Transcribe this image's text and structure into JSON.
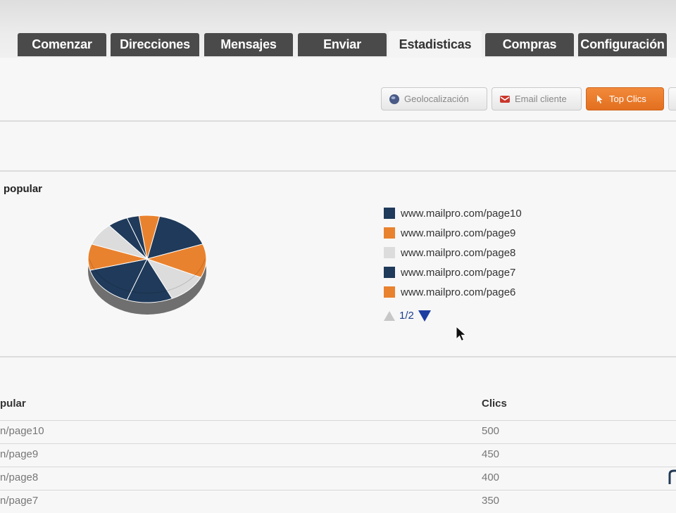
{
  "tabs": [
    {
      "label": "Comenzar",
      "active": false
    },
    {
      "label": "Direcciones",
      "active": false
    },
    {
      "label": "Mensajes",
      "active": false
    },
    {
      "label": "Enviar",
      "active": false
    },
    {
      "label": "Estadisticas",
      "active": true
    },
    {
      "label": "Compras",
      "active": false
    },
    {
      "label": "Configuración",
      "active": false
    }
  ],
  "toolbar": {
    "geo_label": "Geolocalización",
    "email_label": "Email cliente",
    "topclics_label": "Top Clics"
  },
  "section": {
    "title": "popular"
  },
  "legend": {
    "items": [
      {
        "label": "www.mailpro.com/page10",
        "color": "#1f3a5a"
      },
      {
        "label": "www.mailpro.com/page9",
        "color": "#e9822e"
      },
      {
        "label": "www.mailpro.com/page8",
        "color": "#dcdcdc"
      },
      {
        "label": "www.mailpro.com/page7",
        "color": "#1f3a5a"
      },
      {
        "label": "www.mailpro.com/page6",
        "color": "#e9822e"
      }
    ],
    "pager": "1/2"
  },
  "table": {
    "headers": [
      "pular",
      "Clics"
    ],
    "rows": [
      {
        "url": "n/page10",
        "clics": "500"
      },
      {
        "url": "n/page9",
        "clics": "450"
      },
      {
        "url": "n/page8",
        "clics": "400"
      },
      {
        "url": "n/page7",
        "clics": "350"
      }
    ]
  },
  "colors": {
    "navy": "#1f3a5a",
    "orange": "#e9822e",
    "grey": "#dcdcdc"
  }
}
